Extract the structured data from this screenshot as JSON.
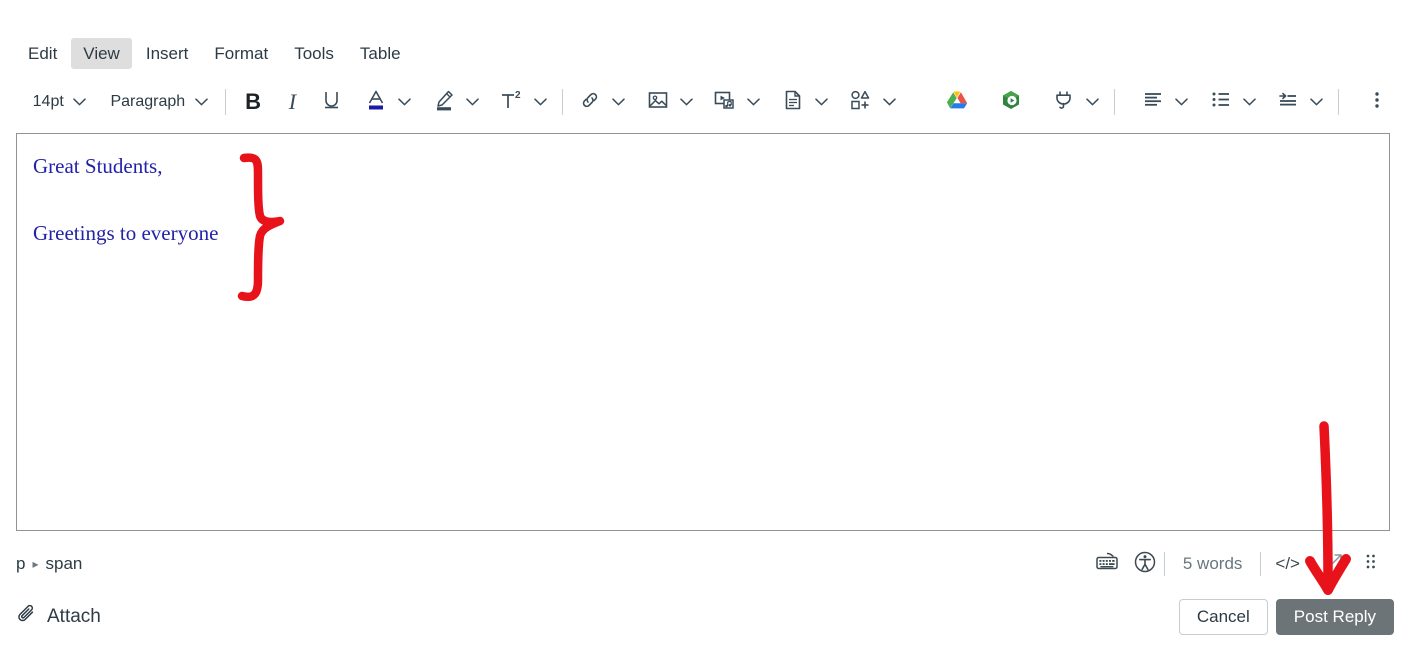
{
  "menubar": {
    "items": [
      {
        "label": "Edit",
        "active": false
      },
      {
        "label": "View",
        "active": true
      },
      {
        "label": "Insert",
        "active": false
      },
      {
        "label": "Format",
        "active": false
      },
      {
        "label": "Tools",
        "active": false
      },
      {
        "label": "Table",
        "active": false
      }
    ]
  },
  "toolbar": {
    "font_size": "14pt",
    "block_format": "Paragraph",
    "bold_label": "B",
    "italic_label": "I",
    "underline_label": "U",
    "superscript_label": "T2",
    "code_label": "</>",
    "icons": {
      "text_color": "text-color-icon",
      "highlight": "highlight-color-icon",
      "superscript": "superscript-icon",
      "link": "link-icon",
      "image": "image-icon",
      "media": "media-icon",
      "document": "document-icon",
      "shapes": "shapes-icon",
      "google_drive": "google-drive-icon",
      "studio": "studio-media-icon",
      "apps": "apps-plug-icon",
      "align": "align-left-icon",
      "list": "bulleted-list-icon",
      "indent": "indent-icon",
      "more": "more-options-icon"
    },
    "colors": {
      "text_color_swatch": "#1a1aa6",
      "highlight_swatch": "#394b58",
      "icon": "#2d3b45",
      "separator": "#c7cdd1",
      "menu_active_bg": "#dedede"
    }
  },
  "editor": {
    "paragraphs": [
      "Great Students,",
      "Greetings to everyone"
    ],
    "text_color": "#2222a8",
    "border_color": "#8e9396"
  },
  "statusbar": {
    "breadcrumb": {
      "root": "p",
      "separator": "▸",
      "leaf": "span"
    },
    "word_count": "5 words",
    "code_label": "</>",
    "icons": {
      "keyboard": "keyboard-icon",
      "accessibility": "accessibility-icon",
      "resize": "resize-arrows-icon",
      "drag_handle": "drag-handle-icon"
    }
  },
  "bottombar": {
    "attach_label": "Attach",
    "attach_icon": "paperclip-icon",
    "cancel_label": "Cancel",
    "post_label": "Post Reply",
    "primary_color": "#6c7478"
  },
  "annotations": {
    "color": "#e8131a",
    "brace": "curly-brace-annotation",
    "arrow": "down-arrow-annotation"
  }
}
